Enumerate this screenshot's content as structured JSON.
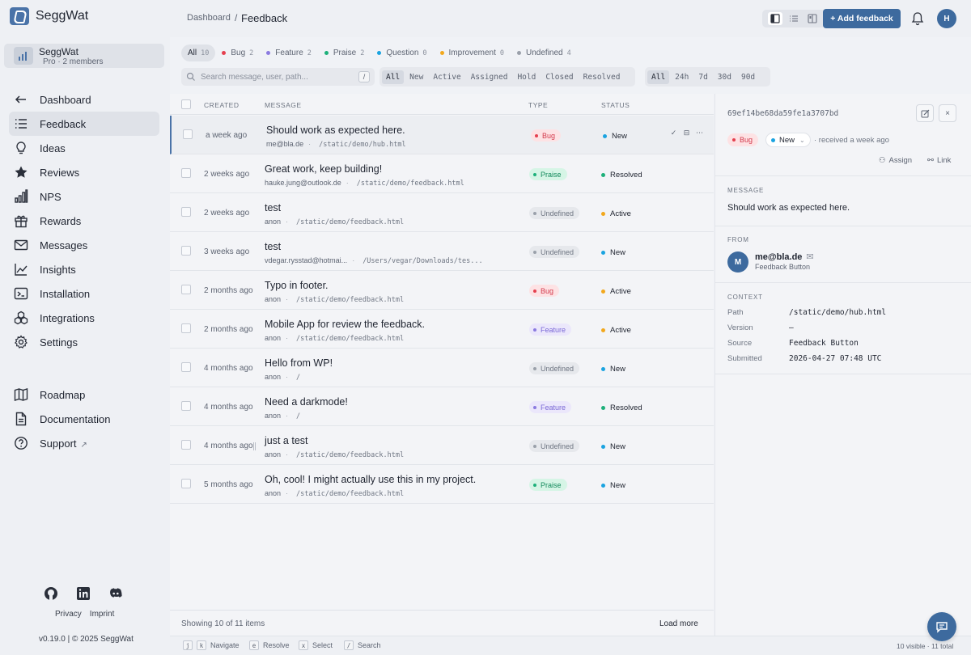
{
  "brand": {
    "name": "SeggWat"
  },
  "org": {
    "name": "SeggWat",
    "meta": "Pro · 2 members"
  },
  "nav_main": [
    {
      "label": "Dashboard",
      "icon": "arrow-left-icon"
    },
    {
      "label": "Feedback",
      "icon": "list-icon",
      "active": true
    },
    {
      "label": "Ideas",
      "icon": "lightbulb-icon"
    },
    {
      "label": "Reviews",
      "icon": "star-icon"
    },
    {
      "label": "NPS",
      "icon": "bar-chart-icon"
    },
    {
      "label": "Rewards",
      "icon": "gift-icon"
    },
    {
      "label": "Messages",
      "icon": "mail-icon"
    },
    {
      "label": "Insights",
      "icon": "trend-icon"
    },
    {
      "label": "Installation",
      "icon": "terminal-icon"
    },
    {
      "label": "Integrations",
      "icon": "blocks-icon"
    },
    {
      "label": "Settings",
      "icon": "gear-icon"
    }
  ],
  "nav_secondary": [
    {
      "label": "Roadmap",
      "icon": "map-icon"
    },
    {
      "label": "Documentation",
      "icon": "document-icon"
    },
    {
      "label": "Support",
      "icon": "help-icon"
    }
  ],
  "footer": {
    "privacy": "Privacy",
    "imprint": "Imprint",
    "version": "v0.19.0 | © 2025 SeggWat"
  },
  "topbar": {
    "crumb_root": "Dashboard",
    "crumb_sep": "/",
    "crumb_current": "Feedback",
    "add_label": "+ Add feedback",
    "avatar": "H"
  },
  "type_filters": [
    {
      "label": "All",
      "count": "10",
      "color": "",
      "active": true
    },
    {
      "label": "Bug",
      "count": "2",
      "color": "#e5404f"
    },
    {
      "label": "Feature",
      "count": "2",
      "color": "#8b7be0"
    },
    {
      "label": "Praise",
      "count": "2",
      "color": "#1db07a"
    },
    {
      "label": "Question",
      "count": "0",
      "color": "#1aa3e0"
    },
    {
      "label": "Improvement",
      "count": "0",
      "color": "#f2a81d"
    },
    {
      "label": "Undefined",
      "count": "4",
      "color": "#9aa0aa"
    }
  ],
  "search": {
    "placeholder": "Search message, user, path...",
    "value": "",
    "shortcut": "/"
  },
  "status_filters": [
    "All",
    "New",
    "Active",
    "Assigned",
    "Hold",
    "Closed",
    "Resolved"
  ],
  "time_filters": [
    "All",
    "24h",
    "7d",
    "30d",
    "90d"
  ],
  "columns": {
    "created": "CREATED",
    "message": "MESSAGE",
    "type": "TYPE",
    "status": "STATUS"
  },
  "rows": [
    {
      "created": "a week ago",
      "message": "Should work as expected here.",
      "user": "me@bla.de",
      "path": "/static/demo/hub.html",
      "type": "Bug",
      "status": "New"
    },
    {
      "created": "2 weeks ago",
      "message": "Great work, keep building!",
      "user": "hauke.jung@outlook.de",
      "path": "/static/demo/feedback.html",
      "type": "Praise",
      "status": "Resolved"
    },
    {
      "created": "2 weeks ago",
      "message": "test",
      "user": "anon",
      "path": "/static/demo/feedback.html",
      "type": "Undefined",
      "status": "Active"
    },
    {
      "created": "3 weeks ago",
      "message": "test",
      "user": "vdegar.rysstad@hotmai...",
      "path": "/Users/vegar/Downloads/tes...",
      "type": "Undefined",
      "status": "New"
    },
    {
      "created": "2 months ago",
      "message": "Typo in footer.",
      "user": "anon",
      "path": "/static/demo/feedback.html",
      "type": "Bug",
      "status": "Active"
    },
    {
      "created": "2 months ago",
      "message": "Mobile App for review the feedback.",
      "user": "anon",
      "path": "/static/demo/feedback.html",
      "type": "Feature",
      "status": "Active"
    },
    {
      "created": "4 months ago",
      "message": "Hello from WP!",
      "user": "anon",
      "path": "/",
      "type": "Undefined",
      "status": "New"
    },
    {
      "created": "4 months ago",
      "message": "Need a darkmode!",
      "user": "anon",
      "path": "/",
      "type": "Feature",
      "status": "Resolved"
    },
    {
      "created": "4 months ago",
      "message": "just a test",
      "user": "anon",
      "path": "/static/demo/feedback.html",
      "type": "Undefined",
      "status": "New"
    },
    {
      "created": "5 months ago",
      "message": "Oh, cool! I might actually use this in my project.",
      "user": "anon",
      "path": "/static/demo/feedback.html",
      "type": "Praise",
      "status": "New"
    }
  ],
  "type_colors": {
    "Bug": {
      "bg": "#fde2e4",
      "fg": "#d33a4c",
      "dot": "#e5404f"
    },
    "Praise": {
      "bg": "#d6f5e6",
      "fg": "#138a5c",
      "dot": "#1db07a"
    },
    "Undefined": {
      "bg": "#e6e8ec",
      "fg": "#6e7582",
      "dot": "#9aa0aa"
    },
    "Feature": {
      "bg": "#ebe7fb",
      "fg": "#7a68d6",
      "dot": "#8b7be0"
    }
  },
  "status_colors": {
    "New": "#1aa3e0",
    "Resolved": "#1db07a",
    "Active": "#f2a81d"
  },
  "table_footer": {
    "showing": "Showing 10 of 11 items",
    "load_more": "Load more"
  },
  "detail": {
    "id": "69ef14be68da59fe1a3707bd",
    "type": "Bug",
    "status": "New",
    "received": "· received a week ago",
    "assign": "Assign",
    "link": "Link",
    "message_label": "MESSAGE",
    "message": "Should work as expected here.",
    "from_label": "FROM",
    "from_avatar": "M",
    "from_email": "me@bla.de",
    "from_source": "Feedback Button",
    "context_label": "CONTEXT",
    "context": [
      {
        "key": "Path",
        "value": "/static/demo/hub.html"
      },
      {
        "key": "Version",
        "value": "—"
      },
      {
        "key": "Source",
        "value": "Feedback Button"
      },
      {
        "key": "Submitted",
        "value": "2026-04-27 07:48 UTC"
      }
    ]
  },
  "shortcuts": [
    {
      "keys": [
        "j",
        "k"
      ],
      "label": "Navigate"
    },
    {
      "keys": [
        "e"
      ],
      "label": "Resolve"
    },
    {
      "keys": [
        "x"
      ],
      "label": "Select"
    },
    {
      "keys": [
        "/"
      ],
      "label": "Search"
    }
  ],
  "visible_count": "10 visible · 11 total"
}
